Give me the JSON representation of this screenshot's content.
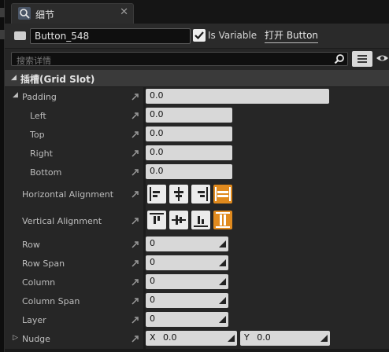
{
  "tab": {
    "title": "细节",
    "icon": "magnifier-icon",
    "close": "✕"
  },
  "header": {
    "widget_icon": "widget-icon",
    "name_value": "Button_548",
    "is_variable_checked": true,
    "is_variable_label": "Is Variable",
    "open_button_label": "打开 Button"
  },
  "search": {
    "placeholder": "搜索详情",
    "icon": "search-icon"
  },
  "view_options_icon": "list-view-icon",
  "visibility_icon": "eye-icon",
  "category": {
    "title": "插槽(Grid Slot)"
  },
  "padding": {
    "label": "Padding",
    "value": "0.0",
    "left_label": "Left",
    "left_value": "0.0",
    "top_label": "Top",
    "top_value": "0.0",
    "right_label": "Right",
    "right_value": "0.0",
    "bottom_label": "Bottom",
    "bottom_value": "0.0"
  },
  "horizontal_alignment": {
    "label": "Horizontal Alignment",
    "options": [
      "align-left",
      "align-center",
      "align-right",
      "fill"
    ],
    "selected": "fill"
  },
  "vertical_alignment": {
    "label": "Vertical Alignment",
    "options": [
      "align-top",
      "align-center",
      "align-bottom",
      "fill"
    ],
    "selected": "fill"
  },
  "row": {
    "label": "Row",
    "value": "0"
  },
  "row_span": {
    "label": "Row Span",
    "value": "0"
  },
  "column": {
    "label": "Column",
    "value": "0"
  },
  "column_span": {
    "label": "Column Span",
    "value": "0"
  },
  "layer": {
    "label": "Layer",
    "value": "0"
  },
  "nudge": {
    "label": "Nudge",
    "x_label": "X",
    "x_value": "0.0",
    "y_label": "Y",
    "y_value": "0.0"
  },
  "colors": {
    "accent_selected": "#e08a1e",
    "panel_bg": "#262626",
    "field_bg": "#d8d8d8"
  }
}
